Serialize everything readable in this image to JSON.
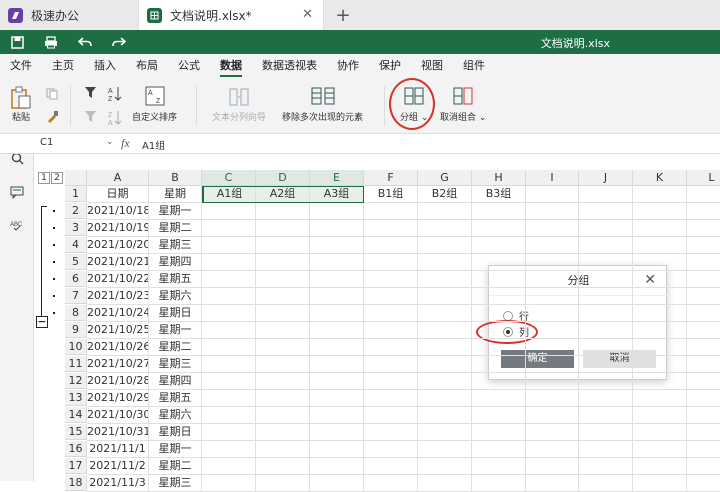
{
  "tabs": [
    {
      "label": "极速办公",
      "icon": "jisu-app-icon",
      "color": "#6b3fa0"
    },
    {
      "label": "文档说明.xlsx*",
      "icon": "sheet-file-icon",
      "color": "#1e6e43"
    }
  ],
  "doc_title": "文档说明.xlsx",
  "menu": [
    "文件",
    "主页",
    "插入",
    "布局",
    "公式",
    "数据",
    "数据透视表",
    "协作",
    "保护",
    "视图",
    "组件"
  ],
  "active_menu": "数据",
  "ribbon": {
    "paste": "粘贴",
    "custom_sort": "自定义排序",
    "text_to_columns": "文本分列向导",
    "remove_dup": "移除多次出现的元素",
    "group": "分组",
    "ungroup": "取消组合"
  },
  "formula": {
    "cell_ref": "C1",
    "fx": "fx",
    "content": "A1组"
  },
  "outline_levels": [
    "1",
    "2"
  ],
  "collapse_btn": "−",
  "columns": [
    "A",
    "B",
    "C",
    "D",
    "E",
    "F",
    "G",
    "H",
    "I",
    "J",
    "K",
    "L"
  ],
  "selected_columns": [
    "C",
    "D",
    "E"
  ],
  "rows": [
    {
      "n": "1",
      "cells": [
        "日期",
        "星期",
        "A1组",
        "A2组",
        "A3组",
        "B1组",
        "B2组",
        "B3组"
      ]
    },
    {
      "n": "2",
      "cells": [
        "2021/10/18",
        "星期一"
      ]
    },
    {
      "n": "3",
      "cells": [
        "2021/10/19",
        "星期二"
      ]
    },
    {
      "n": "4",
      "cells": [
        "2021/10/20",
        "星期三"
      ]
    },
    {
      "n": "5",
      "cells": [
        "2021/10/21",
        "星期四"
      ]
    },
    {
      "n": "6",
      "cells": [
        "2021/10/22",
        "星期五"
      ]
    },
    {
      "n": "7",
      "cells": [
        "2021/10/23",
        "星期六"
      ]
    },
    {
      "n": "8",
      "cells": [
        "2021/10/24",
        "星期日"
      ]
    },
    {
      "n": "9",
      "cells": [
        "2021/10/25",
        "星期一"
      ]
    },
    {
      "n": "10",
      "cells": [
        "2021/10/26",
        "星期二"
      ]
    },
    {
      "n": "11",
      "cells": [
        "2021/10/27",
        "星期三"
      ]
    },
    {
      "n": "12",
      "cells": [
        "2021/10/28",
        "星期四"
      ]
    },
    {
      "n": "13",
      "cells": [
        "2021/10/29",
        "星期五"
      ]
    },
    {
      "n": "14",
      "cells": [
        "2021/10/30",
        "星期六"
      ]
    },
    {
      "n": "15",
      "cells": [
        "2021/10/31",
        "星期日"
      ]
    },
    {
      "n": "16",
      "cells": [
        "2021/11/1",
        "星期一"
      ]
    },
    {
      "n": "17",
      "cells": [
        "2021/11/2",
        "星期二"
      ]
    },
    {
      "n": "18",
      "cells": [
        "2021/11/3",
        "星期三"
      ]
    }
  ],
  "dialog": {
    "title": "分组",
    "close": "✕",
    "option_row": "行",
    "option_col": "列",
    "selected": "列",
    "ok": "确定",
    "cancel": "取消"
  },
  "colors": {
    "brand": "#1e6e43",
    "highlight": "#d9322b"
  }
}
